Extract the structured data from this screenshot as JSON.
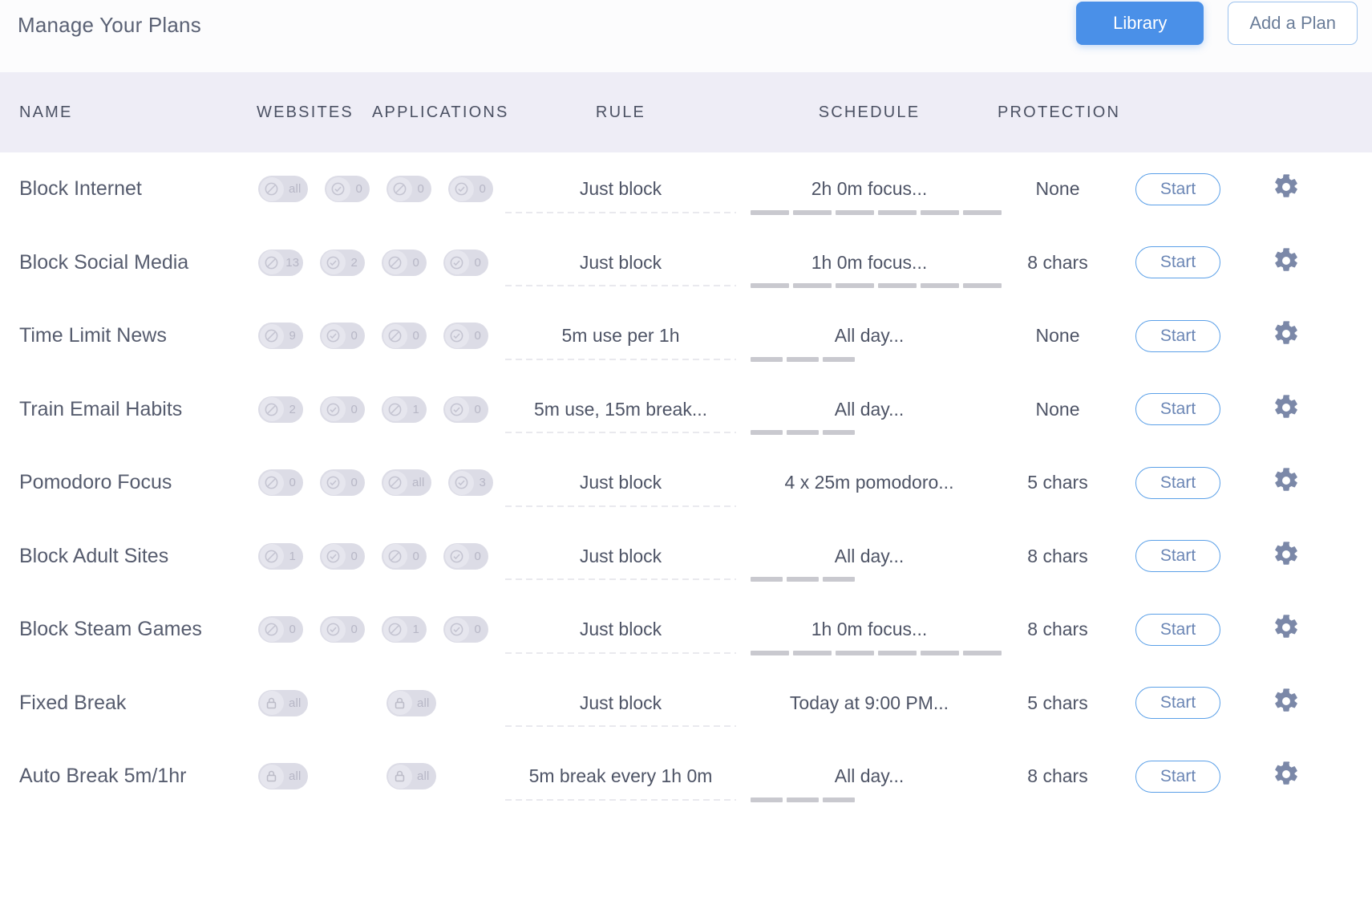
{
  "header": {
    "title": "Manage Your Plans",
    "library_label": "Library",
    "add_plan_label": "Add a Plan",
    "library_color": "#4a90e8"
  },
  "table": {
    "columns": {
      "name": "NAME",
      "websites": "WEBSITES",
      "applications": "APPLICATIONS",
      "rule": "RULE",
      "schedule": "SCHEDULE",
      "protection": "PROTECTION"
    },
    "start_label": "Start",
    "gear_icon": "gear-icon",
    "rows": [
      {
        "name": "Block Internet",
        "badges": [
          {
            "icon": "blocked-circle-icon",
            "count": "all"
          },
          {
            "icon": "allowed-circle-icon",
            "count": "0"
          },
          {
            "icon": "blocked-circle-icon",
            "count": "0"
          },
          {
            "icon": "allowed-circle-icon",
            "count": "0"
          }
        ],
        "rule": "Just block",
        "schedule": "2h 0m focus...",
        "schedule_segments": 6,
        "protection": "None",
        "action": "Start"
      },
      {
        "name": "Block Social Media",
        "badges": [
          {
            "icon": "blocked-circle-icon",
            "count": "13"
          },
          {
            "icon": "allowed-circle-icon",
            "count": "2"
          },
          {
            "icon": "blocked-circle-icon",
            "count": "0"
          },
          {
            "icon": "allowed-circle-icon",
            "count": "0"
          }
        ],
        "rule": "Just block",
        "schedule": "1h 0m focus...",
        "schedule_segments": 6,
        "protection": "8 chars",
        "action": "Start"
      },
      {
        "name": "Time Limit News",
        "badges": [
          {
            "icon": "blocked-circle-icon",
            "count": "9"
          },
          {
            "icon": "allowed-circle-icon",
            "count": "0"
          },
          {
            "icon": "blocked-circle-icon",
            "count": "0"
          },
          {
            "icon": "allowed-circle-icon",
            "count": "0"
          }
        ],
        "rule": "5m use per 1h",
        "schedule": "All day...",
        "schedule_segments": 3,
        "protection": "None",
        "action": "Start"
      },
      {
        "name": "Train Email Habits",
        "badges": [
          {
            "icon": "blocked-circle-icon",
            "count": "2"
          },
          {
            "icon": "allowed-circle-icon",
            "count": "0"
          },
          {
            "icon": "blocked-circle-icon",
            "count": "1"
          },
          {
            "icon": "allowed-circle-icon",
            "count": "0"
          }
        ],
        "rule": "5m use, 15m break...",
        "schedule": "All day...",
        "schedule_segments": 3,
        "protection": "None",
        "action": "Start"
      },
      {
        "name": "Pomodoro Focus",
        "badges": [
          {
            "icon": "blocked-circle-icon",
            "count": "0"
          },
          {
            "icon": "allowed-circle-icon",
            "count": "0"
          },
          {
            "icon": "blocked-circle-icon",
            "count": "all"
          },
          {
            "icon": "allowed-circle-icon",
            "count": "3"
          }
        ],
        "rule": "Just block",
        "schedule": "4 x 25m pomodoro...",
        "schedule_segments": 0,
        "protection": "5 chars",
        "action": "Start"
      },
      {
        "name": "Block Adult Sites",
        "badges": [
          {
            "icon": "blocked-circle-icon",
            "count": "1"
          },
          {
            "icon": "allowed-circle-icon",
            "count": "0"
          },
          {
            "icon": "blocked-circle-icon",
            "count": "0"
          },
          {
            "icon": "allowed-circle-icon",
            "count": "0"
          }
        ],
        "rule": "Just block",
        "schedule": "All day...",
        "schedule_segments": 3,
        "protection": "8 chars",
        "action": "Start"
      },
      {
        "name": "Block Steam Games",
        "badges": [
          {
            "icon": "blocked-circle-icon",
            "count": "0"
          },
          {
            "icon": "allowed-circle-icon",
            "count": "0"
          },
          {
            "icon": "blocked-circle-icon",
            "count": "1"
          },
          {
            "icon": "allowed-circle-icon",
            "count": "0"
          }
        ],
        "rule": "Just block",
        "schedule": "1h 0m focus...",
        "schedule_segments": 6,
        "protection": "8 chars",
        "action": "Start"
      },
      {
        "name": "Fixed Break",
        "badges": [
          {
            "icon": "lock-icon",
            "count": "all"
          },
          {
            "icon": "spacer",
            "count": ""
          },
          {
            "icon": "lock-icon",
            "count": "all"
          },
          {
            "icon": "spacer",
            "count": ""
          }
        ],
        "rule": "Just block",
        "schedule": "Today at 9:00 PM...",
        "schedule_segments": 0,
        "protection": "5 chars",
        "action": "Start"
      },
      {
        "name": "Auto Break 5m/1hr",
        "badges": [
          {
            "icon": "lock-icon",
            "count": "all"
          },
          {
            "icon": "spacer",
            "count": ""
          },
          {
            "icon": "lock-icon",
            "count": "all"
          },
          {
            "icon": "spacer",
            "count": ""
          }
        ],
        "rule": "5m break every 1h 0m",
        "schedule": "All day...",
        "schedule_segments": 3,
        "protection": "8 chars",
        "action": "Start"
      }
    ]
  }
}
